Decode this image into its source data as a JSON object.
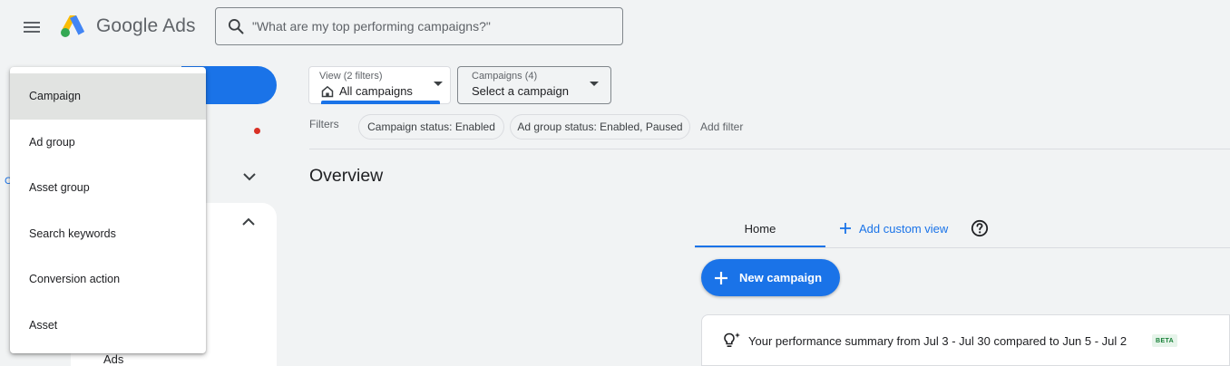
{
  "header": {
    "brand": "Google Ads",
    "search_placeholder": "\"What are my top performing campaigns?\""
  },
  "sidebar": {
    "section_label": "Ads",
    "partial_left_char": "C"
  },
  "dropdown_menu": {
    "selected": "Campaign",
    "items": [
      "Campaign",
      "Ad group",
      "Asset group",
      "Search keywords",
      "Conversion action",
      "Asset"
    ]
  },
  "view_selector": {
    "caption": "View (2 filters)",
    "value": "All campaigns"
  },
  "campaign_selector": {
    "caption": "Campaigns (4)",
    "value": "Select a campaign"
  },
  "filters": {
    "label": "Filters",
    "chips": [
      "Campaign status: Enabled",
      "Ad group status: Enabled, Paused"
    ],
    "add_filter": "Add filter"
  },
  "main": {
    "title": "Overview",
    "tabs": {
      "home": "Home",
      "add_custom_view": "Add custom view"
    },
    "new_campaign_label": "New campaign",
    "summary": {
      "text": "Your performance summary from Jul 3 - Jul 30 compared to Jun 5 - Jul 2",
      "badge": "BETA"
    }
  },
  "colors": {
    "accent": "#1a73e8",
    "background": "#f1f3f4",
    "badge_bg": "#e6f4ea",
    "badge_fg": "#188038",
    "alert_dot": "#d93025"
  }
}
